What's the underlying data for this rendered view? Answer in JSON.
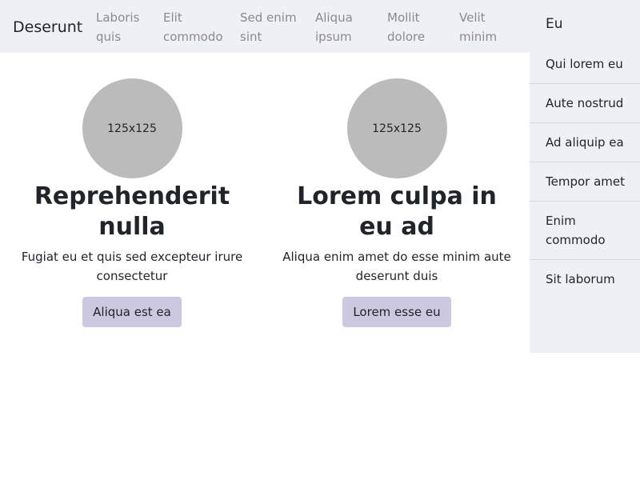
{
  "navbar": {
    "brand": "Deserunt",
    "links": [
      "Laboris quis",
      "Elit commodo",
      "Sed enim sint",
      "Aliqua ipsum",
      "Mollit dolore",
      "Velit minim"
    ]
  },
  "sidebar": {
    "title": "Eu",
    "items": [
      "Qui lorem eu",
      "Aute nostrud",
      "Ad aliquip ea",
      "Tempor amet",
      "Enim commodo",
      "Sit laborum"
    ]
  },
  "cards": [
    {
      "image_label": "125x125",
      "title": "Reprehenderit nulla",
      "text": "Fugiat eu et quis sed excepteur irure consectetur",
      "button": "Aliqua est ea"
    },
    {
      "image_label": "125x125",
      "title": "Lorem culpa in eu ad",
      "text": "Aliqua enim amet do esse minim aute deserunt duis",
      "button": "Lorem esse eu"
    }
  ],
  "colors": {
    "navbar_bg": "#efeff6",
    "sidebar_bg": "#efeff6",
    "button_bg": "#cbc8e0",
    "avatar_bg": "#bbbbbb",
    "nav_link": "#8a8a8e"
  }
}
